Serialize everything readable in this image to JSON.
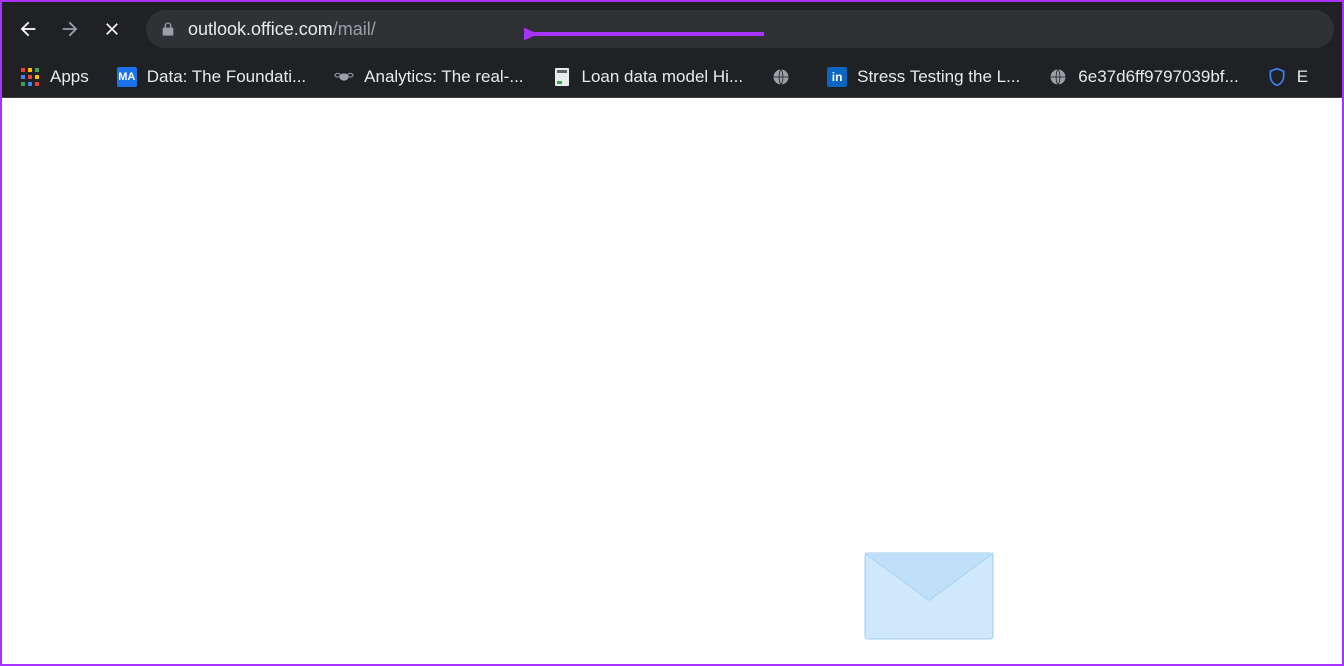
{
  "address_bar": {
    "domain": "outlook.office.com",
    "path": "/mail/"
  },
  "bookmarks": {
    "apps_label": "Apps",
    "items": [
      {
        "label": "Data: The Foundati...",
        "icon_text": "MA",
        "icon_bg": "#1a73e8",
        "icon_fg": "#ffffff"
      },
      {
        "label": "Analytics: The real-...",
        "icon_text": "",
        "icon_bg": "transparent",
        "icon_fg": "#9aa0a6",
        "icon_svg": "bee"
      },
      {
        "label": "Loan data model Hi...",
        "icon_text": "",
        "icon_bg": "transparent",
        "icon_fg": "#9aa0a6",
        "icon_svg": "doc"
      },
      {
        "label": "",
        "icon_text": "",
        "icon_bg": "transparent",
        "icon_fg": "#9aa0a6",
        "icon_svg": "globe"
      },
      {
        "label": "Stress Testing the L...",
        "icon_text": "in",
        "icon_bg": "#0a66c2",
        "icon_fg": "#ffffff"
      },
      {
        "label": "6e37d6ff9797039bf...",
        "icon_text": "",
        "icon_bg": "transparent",
        "icon_fg": "#9aa0a6",
        "icon_svg": "globe"
      },
      {
        "label": "E",
        "icon_text": "",
        "icon_bg": "transparent",
        "icon_fg": "#3b82f6",
        "icon_svg": "shield"
      }
    ]
  },
  "annotation": {
    "color": "#a832ff"
  }
}
